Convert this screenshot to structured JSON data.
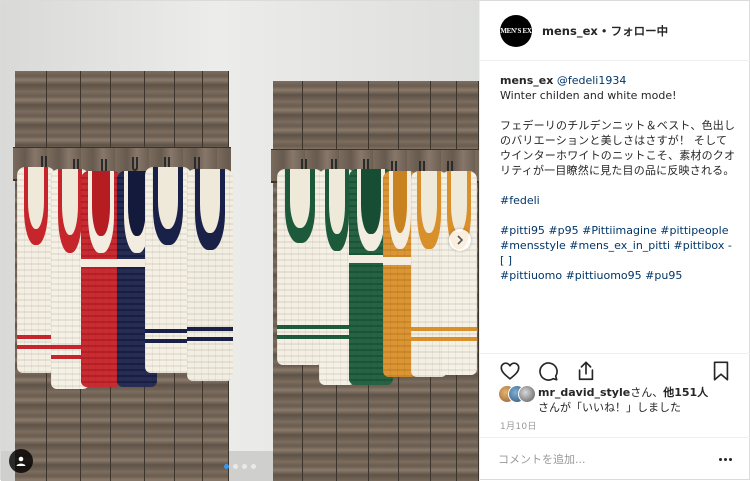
{
  "post": {
    "account": {
      "username": "mens_ex",
      "avatar_text": "MEN'S EX",
      "separator": "•",
      "follow_status": "フォロー中"
    },
    "caption": {
      "username": "mens_ex",
      "mention": "@fedeli1934",
      "title": "Winter childen and white mode!",
      "body": "フェデーリのチルデンニット＆ベスト、色出しのバリエーションと美しさはさすが！ そしてウインターホワイトのニットこそ、素材のクオリティが一目瞭然に見た目の品に反映される。",
      "brand_tag": "#fedeli",
      "hashtags_line1": "#pitti95 #p95 #Pittiimagine #pittipeople #mensstyle #mens_ex_in_pitti #pittibox - [ ]",
      "hashtags_line2": "#pittiuomo #pittiuomo95 #pu95"
    },
    "likes": {
      "first_user": "mr_david_style",
      "suffix_1": "さん、",
      "others_count": "他151人",
      "line2": "さんが「いいね！」しました"
    },
    "date": "1月10日",
    "comment": {
      "placeholder": "コメントを追加..."
    },
    "carousel": {
      "total": 4,
      "current": 1
    }
  },
  "colors": {
    "accent": "#3897f0",
    "text": "#262626",
    "link": "#003569",
    "muted": "#999999"
  },
  "icons": [
    "heart-icon",
    "comment-icon",
    "share-icon",
    "bookmark-icon",
    "user-tag-icon",
    "chevron-right-icon",
    "more-icon"
  ]
}
